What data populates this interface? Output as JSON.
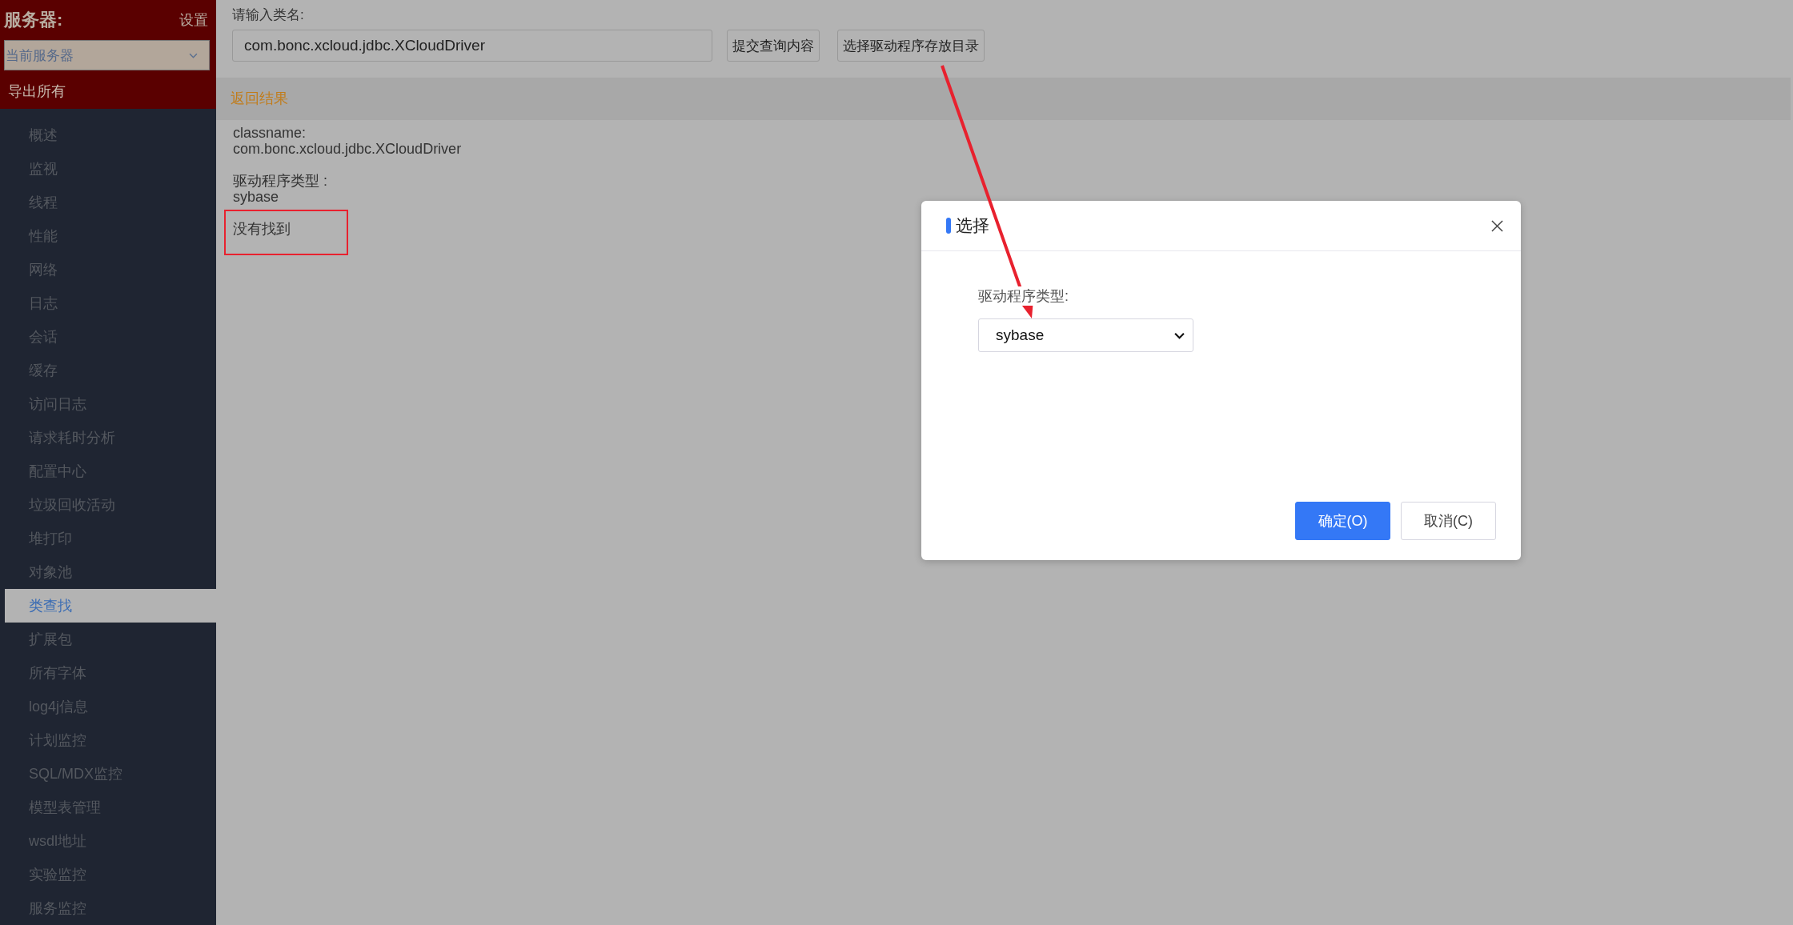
{
  "sidebar": {
    "title": "服务器:",
    "settings_link": "设置",
    "server_select": {
      "value": "当前服务器"
    },
    "export_all": "导出所有",
    "items": [
      {
        "label": "概述",
        "selected": false
      },
      {
        "label": "监视",
        "selected": false
      },
      {
        "label": "线程",
        "selected": false
      },
      {
        "label": "性能",
        "selected": false
      },
      {
        "label": "网络",
        "selected": false
      },
      {
        "label": "日志",
        "selected": false
      },
      {
        "label": "会话",
        "selected": false
      },
      {
        "label": "缓存",
        "selected": false
      },
      {
        "label": "访问日志",
        "selected": false
      },
      {
        "label": "请求耗时分析",
        "selected": false
      },
      {
        "label": "配置中心",
        "selected": false
      },
      {
        "label": "垃圾回收活动",
        "selected": false
      },
      {
        "label": "堆打印",
        "selected": false
      },
      {
        "label": "对象池",
        "selected": false
      },
      {
        "label": "类查找",
        "selected": true
      },
      {
        "label": "扩展包",
        "selected": false
      },
      {
        "label": "所有字体",
        "selected": false
      },
      {
        "label": "log4j信息",
        "selected": false
      },
      {
        "label": "计划监控",
        "selected": false
      },
      {
        "label": "SQL/MDX监控",
        "selected": false
      },
      {
        "label": "模型表管理",
        "selected": false
      },
      {
        "label": "wsdl地址",
        "selected": false
      },
      {
        "label": "实验监控",
        "selected": false
      },
      {
        "label": "服务监控",
        "selected": false
      }
    ]
  },
  "query": {
    "label": "请输入类名:",
    "value": "com.bonc.xcloud.jdbc.XCloudDriver",
    "buttons": [
      "提交查询内容",
      "选择驱动程序存放目录"
    ]
  },
  "results": {
    "title": "返回结果",
    "entries": [
      {
        "label": "classname:",
        "value": "com.bonc.xcloud.jdbc.XCloudDriver"
      },
      {
        "label": "驱动程序类型 :",
        "value": "sybase"
      }
    ],
    "message": "没有找到"
  },
  "dialog": {
    "title": "选择",
    "field_label": "驱动程序类型:",
    "select_value": "sybase",
    "buttons": [
      {
        "label": "确定(O)",
        "kind": "primary"
      },
      {
        "label": "取消(C)",
        "kind": "secondary"
      }
    ]
  }
}
